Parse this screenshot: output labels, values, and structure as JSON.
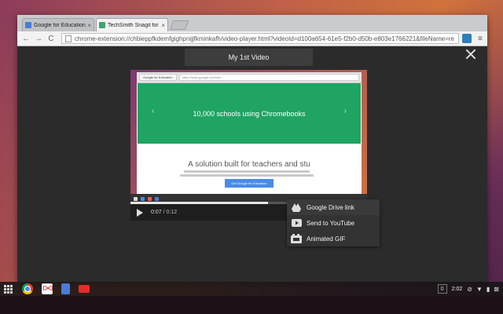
{
  "browser": {
    "tabs": [
      {
        "title": "Google for Education: A",
        "favicon": "google-favicon",
        "active": false
      },
      {
        "title": "TechSmith Snagit for Goo",
        "favicon": "snagit-favicon",
        "active": true
      }
    ],
    "url": "chrome-extension://chbieppfkdemfgighpnijjfkminkafh/video-player.html?videoId=d100a654-61e5-f2b0-d50b-e803e1766221&fileName=re",
    "tab_close_glyph": "×",
    "back_glyph": "←",
    "forward_glyph": "→",
    "reload_glyph": "C",
    "menu_glyph": "≡"
  },
  "player": {
    "title": "My 1st Video",
    "current_time": "0:07",
    "duration": "/ 0:12",
    "progress_fraction": 0.58,
    "accent": "#2a8ac7"
  },
  "video_frame": {
    "inner_tab": "Google for Education",
    "inner_url": "https://www.google.com/edu",
    "hero_text": "10,000 schools using Chromebooks",
    "headline": "A solution built for teachers and stu",
    "cta": "Get Google for Education",
    "hero_color": "#1fa463",
    "prev_glyph": "‹",
    "next_glyph": "›"
  },
  "share_menu": {
    "items": [
      {
        "label": "Google Drive link",
        "icon": "google-drive-icon"
      },
      {
        "label": "Send to YouTube",
        "icon": "youtube-icon"
      },
      {
        "label": "Animated GIF",
        "icon": "gif-icon"
      }
    ]
  },
  "shelf": {
    "apps": [
      "chrome-icon",
      "gmail-icon",
      "docs-icon",
      "youtube-icon"
    ],
    "notification_count": "0",
    "clock": "2:02"
  }
}
